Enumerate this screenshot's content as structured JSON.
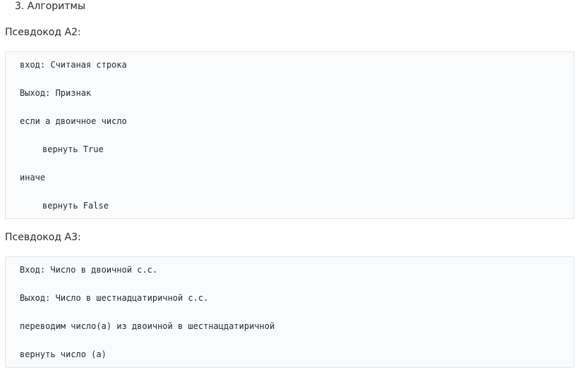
{
  "heading": "3. Алгоритмы",
  "blocks": [
    {
      "label": "Псевдокод А2:",
      "lines": [
        "вход: Считаная строка",
        "Выход: Признак",
        "если а двоичное число",
        "вернуть True",
        "иначе",
        "вернуть False"
      ]
    },
    {
      "label": "Псевдокод А3:",
      "lines": [
        "Вход: Число в двоичной с.с.",
        "Выход: Число в шестнадцатиричной с.с.",
        "переводим число(а) из двоичной в шестнацдатиричной",
        "вернуть число (а)"
      ]
    }
  ]
}
